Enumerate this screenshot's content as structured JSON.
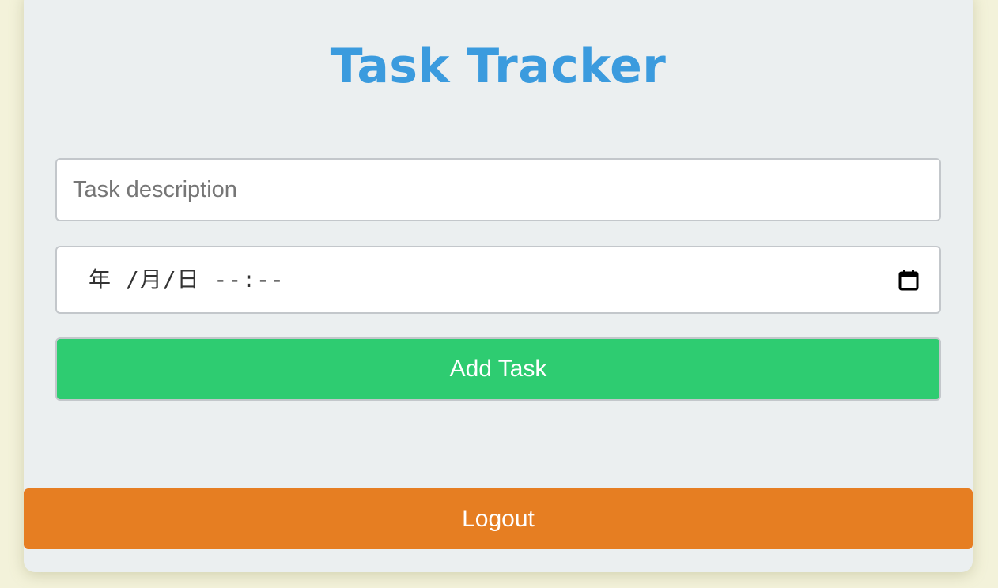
{
  "app": {
    "title": "Task Tracker"
  },
  "form": {
    "description": {
      "placeholder": "Task description",
      "value": ""
    },
    "due": {
      "display": "年 /月/日 --:--",
      "icon": "calendar-icon"
    },
    "add_label": "Add Task"
  },
  "logout_label": "Logout",
  "colors": {
    "page_background": "#f3f2da",
    "card_background": "#ebeff0",
    "title": "#3b9bde",
    "add_button": "#2ecc71",
    "logout_button": "#e67e22"
  }
}
